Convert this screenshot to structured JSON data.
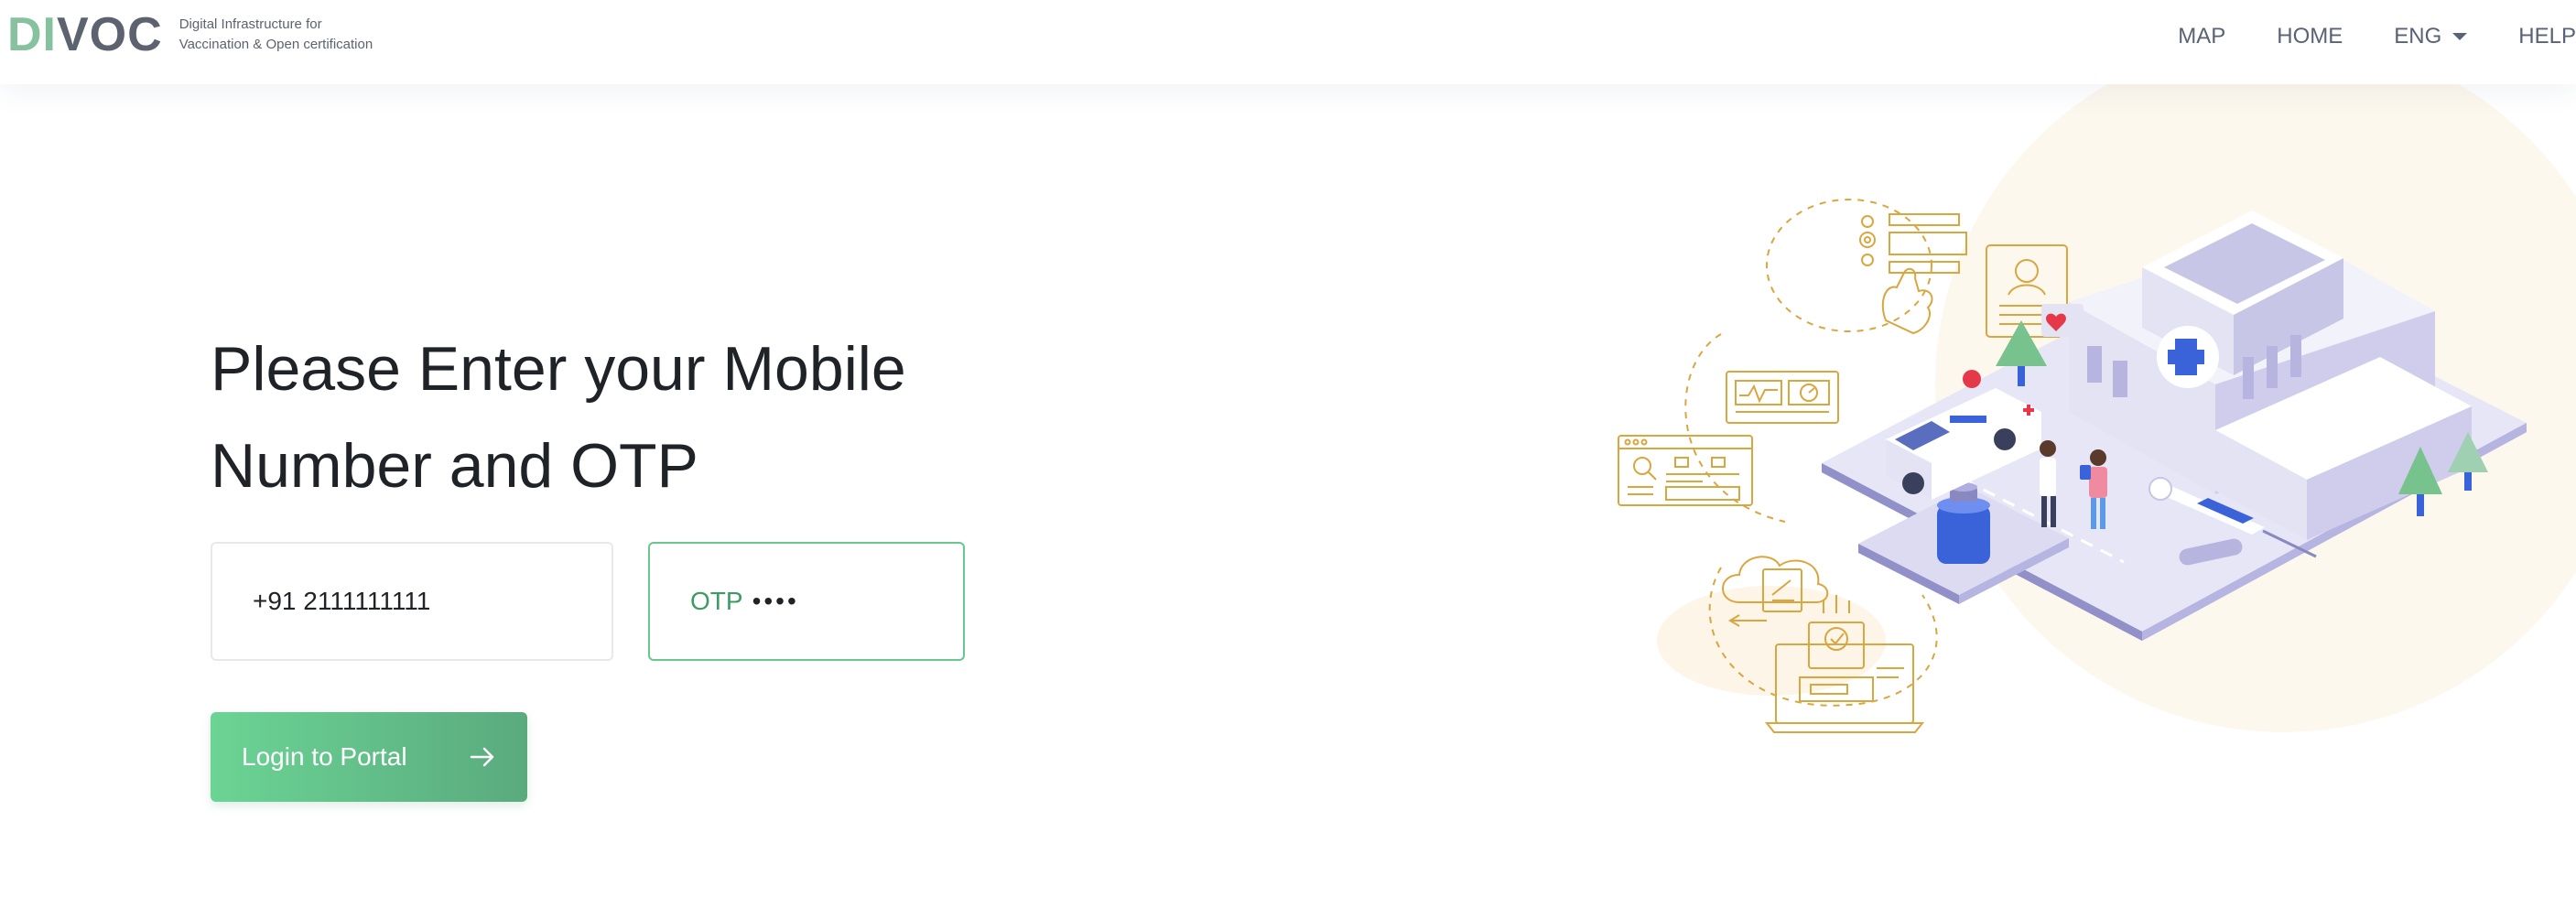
{
  "header": {
    "logo": {
      "mark_part1": "DI",
      "mark_part2": "VOC",
      "tagline_line1": "Digital Infrastructure for",
      "tagline_line2": "Vaccination & Open certification"
    },
    "nav": {
      "map": "MAP",
      "home": "HOME",
      "language": "ENG",
      "help": "HELP"
    }
  },
  "main": {
    "heading": "Please Enter your Mobile Number and OTP",
    "mobile_value": "+91 2111111111",
    "otp_label": "OTP",
    "otp_mask": "••••",
    "login_button": "Login to Portal"
  },
  "colors": {
    "brand_green": "#86c2a0",
    "brand_gray": "#5d6270",
    "button_gradient_start": "#6bd494",
    "button_gradient_end": "#5aaa7e",
    "otp_border": "#68c68f",
    "illustration_gold": "#d9a640",
    "illustration_lavender": "#c7c6e6",
    "illustration_blue": "#3a62d9"
  },
  "icons": {
    "language_dropdown": "caret-down-icon",
    "login_arrow": "arrow-right-icon"
  }
}
